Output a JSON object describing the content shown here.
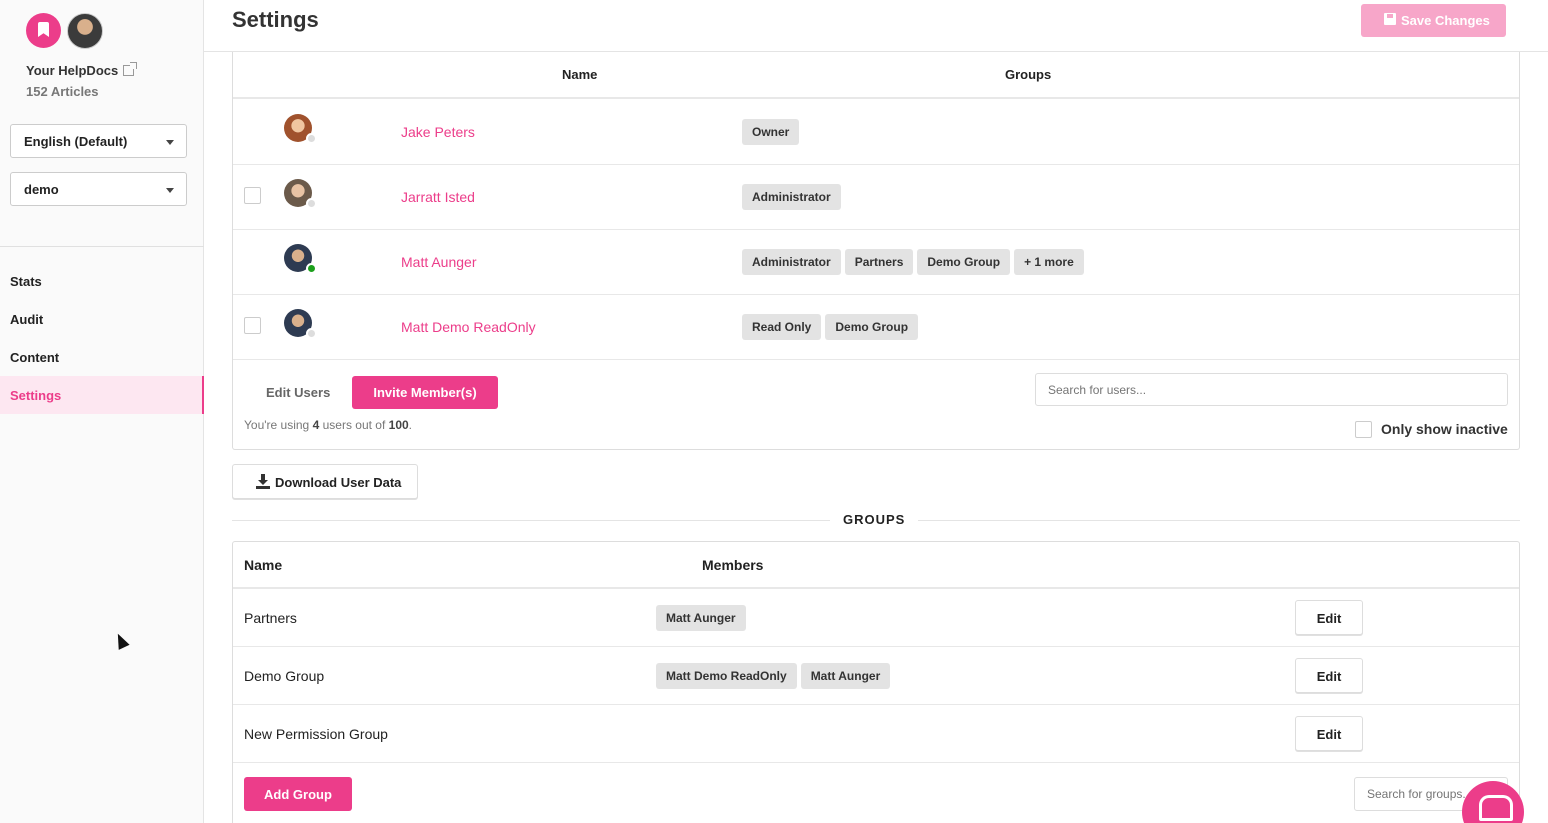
{
  "sidebar": {
    "brand": "Your HelpDocs",
    "article_count": "152 Articles",
    "language_select": "English (Default)",
    "workspace_select": "demo",
    "nav": [
      {
        "label": "Stats"
      },
      {
        "label": "Audit"
      },
      {
        "label": "Content"
      },
      {
        "label": "Settings",
        "active": true
      }
    ]
  },
  "header": {
    "title": "Settings",
    "save_label": "Save Changes"
  },
  "users": {
    "columns": {
      "name": "Name",
      "groups": "Groups"
    },
    "rows": [
      {
        "name": "Jake Peters",
        "groups": [
          "Owner"
        ],
        "online": false
      },
      {
        "name": "Jarratt Isted",
        "groups": [
          "Administrator"
        ],
        "online": false
      },
      {
        "name": "Matt Aunger",
        "groups": [
          "Administrator",
          "Partners",
          "Demo Group",
          "+ 1 more"
        ],
        "online": true
      },
      {
        "name": "Matt Demo ReadOnly",
        "groups": [
          "Read Only",
          "Demo Group"
        ],
        "online": false
      }
    ],
    "edit_users_label": "Edit Users",
    "invite_label": "Invite Member(s)",
    "usage_prefix": "You're using ",
    "usage_count": "4",
    "usage_middle": " users out of ",
    "usage_total": "100",
    "usage_suffix": ".",
    "search_placeholder": "Search for users...",
    "inactive_label": "Only show inactive",
    "download_label": "Download User Data"
  },
  "groups": {
    "heading": "GROUPS",
    "columns": {
      "name": "Name",
      "members": "Members"
    },
    "rows": [
      {
        "name": "Partners",
        "members": [
          "Matt Aunger"
        ]
      },
      {
        "name": "Demo Group",
        "members": [
          "Matt Demo ReadOnly",
          "Matt Aunger"
        ]
      },
      {
        "name": "New Permission Group",
        "members": []
      }
    ],
    "edit_label": "Edit",
    "add_label": "Add Group",
    "search_placeholder": "Search for groups..."
  },
  "colors": {
    "accent": "#ec3d8a",
    "accent_disabled": "#f7a6c9",
    "online": "#1ca01c"
  },
  "icons": [
    "external-link-icon",
    "caret-down-icon",
    "floppy-disk-icon",
    "download-icon",
    "chat-icon"
  ]
}
